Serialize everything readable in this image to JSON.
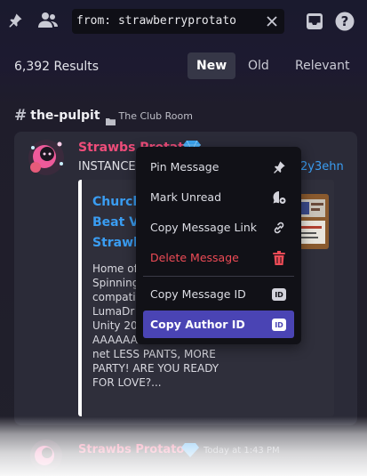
{
  "search": {
    "query": "from: strawberryprotato"
  },
  "results": {
    "count_label": "6,392 Results",
    "sort_options": [
      "New",
      "Old",
      "Relevant"
    ],
    "active_sort": "New"
  },
  "channel": {
    "name": "the-pulpit",
    "category": "The Club Room"
  },
  "message": {
    "author": "Strawbs Protato",
    "text_prefix": "INSTANCE",
    "link_suffix": "2y3ehn",
    "embed": {
      "title_lines": [
        "Church",
        "Beat V3",
        "Strawb"
      ],
      "description_lines": [
        "Home of",
        "Spinning",
        "compati",
        "LumaDr",
        "Unity 20",
        "AAAAAAA! discord . s4vr .",
        "net LESS PANTS, MORE",
        "PARTY! ARE YOU READY",
        "FOR LOVE?..."
      ]
    }
  },
  "context_menu": {
    "items": [
      {
        "label": "Pin Message",
        "icon": "pin-icon"
      },
      {
        "label": "Mark Unread",
        "icon": "mark-unread-icon"
      },
      {
        "label": "Copy Message Link",
        "icon": "link-icon"
      },
      {
        "label": "Delete Message",
        "icon": "trash-icon",
        "danger": true
      },
      {
        "label": "Copy Message ID",
        "icon": "id-icon"
      },
      {
        "label": "Copy Author ID",
        "icon": "id-icon",
        "selected": true
      }
    ],
    "id_badge_text": "ID"
  },
  "next_message": {
    "author": "Strawbs Protato",
    "timestamp": "Today at 1:43 PM"
  },
  "colors": {
    "accent": "#4a44b4",
    "author": "#ee4d7a",
    "link": "#3a9df2",
    "danger": "#ee4b56",
    "badge": "#3ba4f0"
  }
}
